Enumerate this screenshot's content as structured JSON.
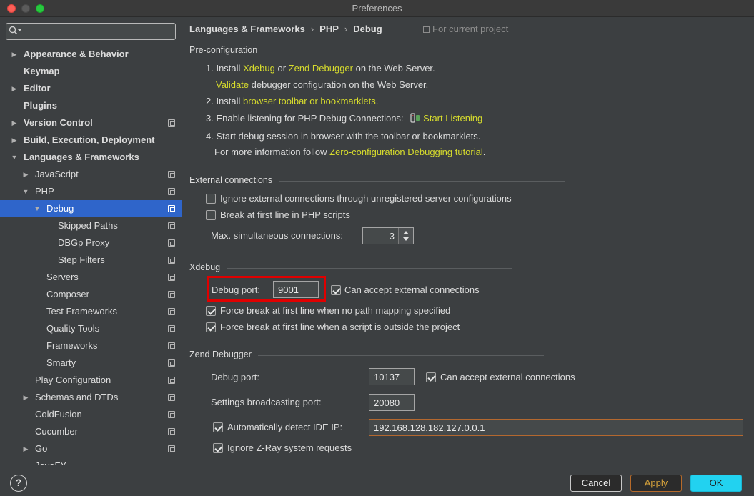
{
  "window": {
    "title": "Preferences"
  },
  "search": {
    "placeholder": ""
  },
  "sidebar": {
    "items": [
      {
        "label": "Appearance & Behavior",
        "bold": true,
        "arrow": "right",
        "indent": 0,
        "copy": false
      },
      {
        "label": "Keymap",
        "bold": true,
        "arrow": "",
        "indent": 0,
        "copy": false
      },
      {
        "label": "Editor",
        "bold": true,
        "arrow": "right",
        "indent": 0,
        "copy": false
      },
      {
        "label": "Plugins",
        "bold": true,
        "arrow": "",
        "indent": 0,
        "copy": false
      },
      {
        "label": "Version Control",
        "bold": true,
        "arrow": "right",
        "indent": 0,
        "copy": true
      },
      {
        "label": "Build, Execution, Deployment",
        "bold": true,
        "arrow": "right",
        "indent": 0,
        "copy": false
      },
      {
        "label": "Languages & Frameworks",
        "bold": true,
        "arrow": "down",
        "indent": 0,
        "copy": false
      },
      {
        "label": "JavaScript",
        "bold": false,
        "arrow": "right",
        "indent": 1,
        "copy": true
      },
      {
        "label": "PHP",
        "bold": false,
        "arrow": "down",
        "indent": 1,
        "copy": true
      },
      {
        "label": "Debug",
        "bold": false,
        "arrow": "down",
        "indent": 2,
        "copy": true,
        "selected": true
      },
      {
        "label": "Skipped Paths",
        "bold": false,
        "arrow": "",
        "indent": 3,
        "copy": true
      },
      {
        "label": "DBGp Proxy",
        "bold": false,
        "arrow": "",
        "indent": 3,
        "copy": true
      },
      {
        "label": "Step Filters",
        "bold": false,
        "arrow": "",
        "indent": 3,
        "copy": true
      },
      {
        "label": "Servers",
        "bold": false,
        "arrow": "",
        "indent": 2,
        "copy": true
      },
      {
        "label": "Composer",
        "bold": false,
        "arrow": "",
        "indent": 2,
        "copy": true
      },
      {
        "label": "Test Frameworks",
        "bold": false,
        "arrow": "",
        "indent": 2,
        "copy": true
      },
      {
        "label": "Quality Tools",
        "bold": false,
        "arrow": "",
        "indent": 2,
        "copy": true
      },
      {
        "label": "Frameworks",
        "bold": false,
        "arrow": "",
        "indent": 2,
        "copy": true
      },
      {
        "label": "Smarty",
        "bold": false,
        "arrow": "",
        "indent": 2,
        "copy": true
      },
      {
        "label": "Play Configuration",
        "bold": false,
        "arrow": "",
        "indent": 1,
        "copy": true
      },
      {
        "label": "Schemas and DTDs",
        "bold": false,
        "arrow": "right",
        "indent": 1,
        "copy": true
      },
      {
        "label": "ColdFusion",
        "bold": false,
        "arrow": "",
        "indent": 1,
        "copy": true
      },
      {
        "label": "Cucumber",
        "bold": false,
        "arrow": "",
        "indent": 1,
        "copy": true
      },
      {
        "label": "Go",
        "bold": false,
        "arrow": "right",
        "indent": 1,
        "copy": true
      },
      {
        "label": "JavaFX",
        "bold": false,
        "arrow": "",
        "indent": 1,
        "copy": false
      }
    ]
  },
  "breadcrumb": {
    "a": "Languages & Frameworks",
    "b": "PHP",
    "c": "Debug",
    "sep": "›"
  },
  "for_project": "For current project",
  "preconfig": {
    "title": "Pre-configuration",
    "step1_a": "1. Install ",
    "xdebug": "Xdebug",
    "step1_or": " or ",
    "zend": "Zend Debugger",
    "step1_b": " on the Web Server.",
    "validate": "Validate",
    "validate_rest": " debugger configuration on the Web Server.",
    "step2_a": "2. Install ",
    "toolbar": "browser toolbar or bookmarklets",
    "step2_b": ".",
    "step3": "3. Enable listening for PHP Debug Connections:",
    "start_listening": "Start Listening",
    "step4": "4. Start debug session in browser with the toolbar or bookmarklets.",
    "more_a": "For more information follow ",
    "tutorial": "Zero-configuration Debugging tutorial",
    "more_b": "."
  },
  "external": {
    "title": "External connections",
    "ignore": "Ignore external connections through unregistered server configurations",
    "break_first": "Break at first line in PHP scripts",
    "max_label": "Max. simultaneous connections:",
    "max_value": "3"
  },
  "xdebug": {
    "title": "Xdebug",
    "port_label": "Debug port:",
    "port_value": "9001",
    "accept_ext": "Can accept external connections",
    "force_no_mapping": "Force break at first line when no path mapping specified",
    "force_outside": "Force break at first line when a script is outside the project"
  },
  "zend": {
    "title": "Zend Debugger",
    "port_label": "Debug port:",
    "port_value": "10137",
    "accept_ext": "Can accept external connections",
    "broadcast_label": "Settings broadcasting port:",
    "broadcast_value": "20080",
    "auto_detect": "Automatically detect IDE IP:",
    "ip_value": "192.168.128.182,127.0.0.1",
    "ignore_zray": "Ignore Z-Ray system requests"
  },
  "buttons": {
    "help": "?",
    "cancel": "Cancel",
    "apply": "Apply",
    "ok": "OK"
  },
  "colors": {
    "link": "#d7dc2d",
    "selection": "#2f65ca",
    "ok": "#22d2f0",
    "highlight": "#e00000"
  }
}
